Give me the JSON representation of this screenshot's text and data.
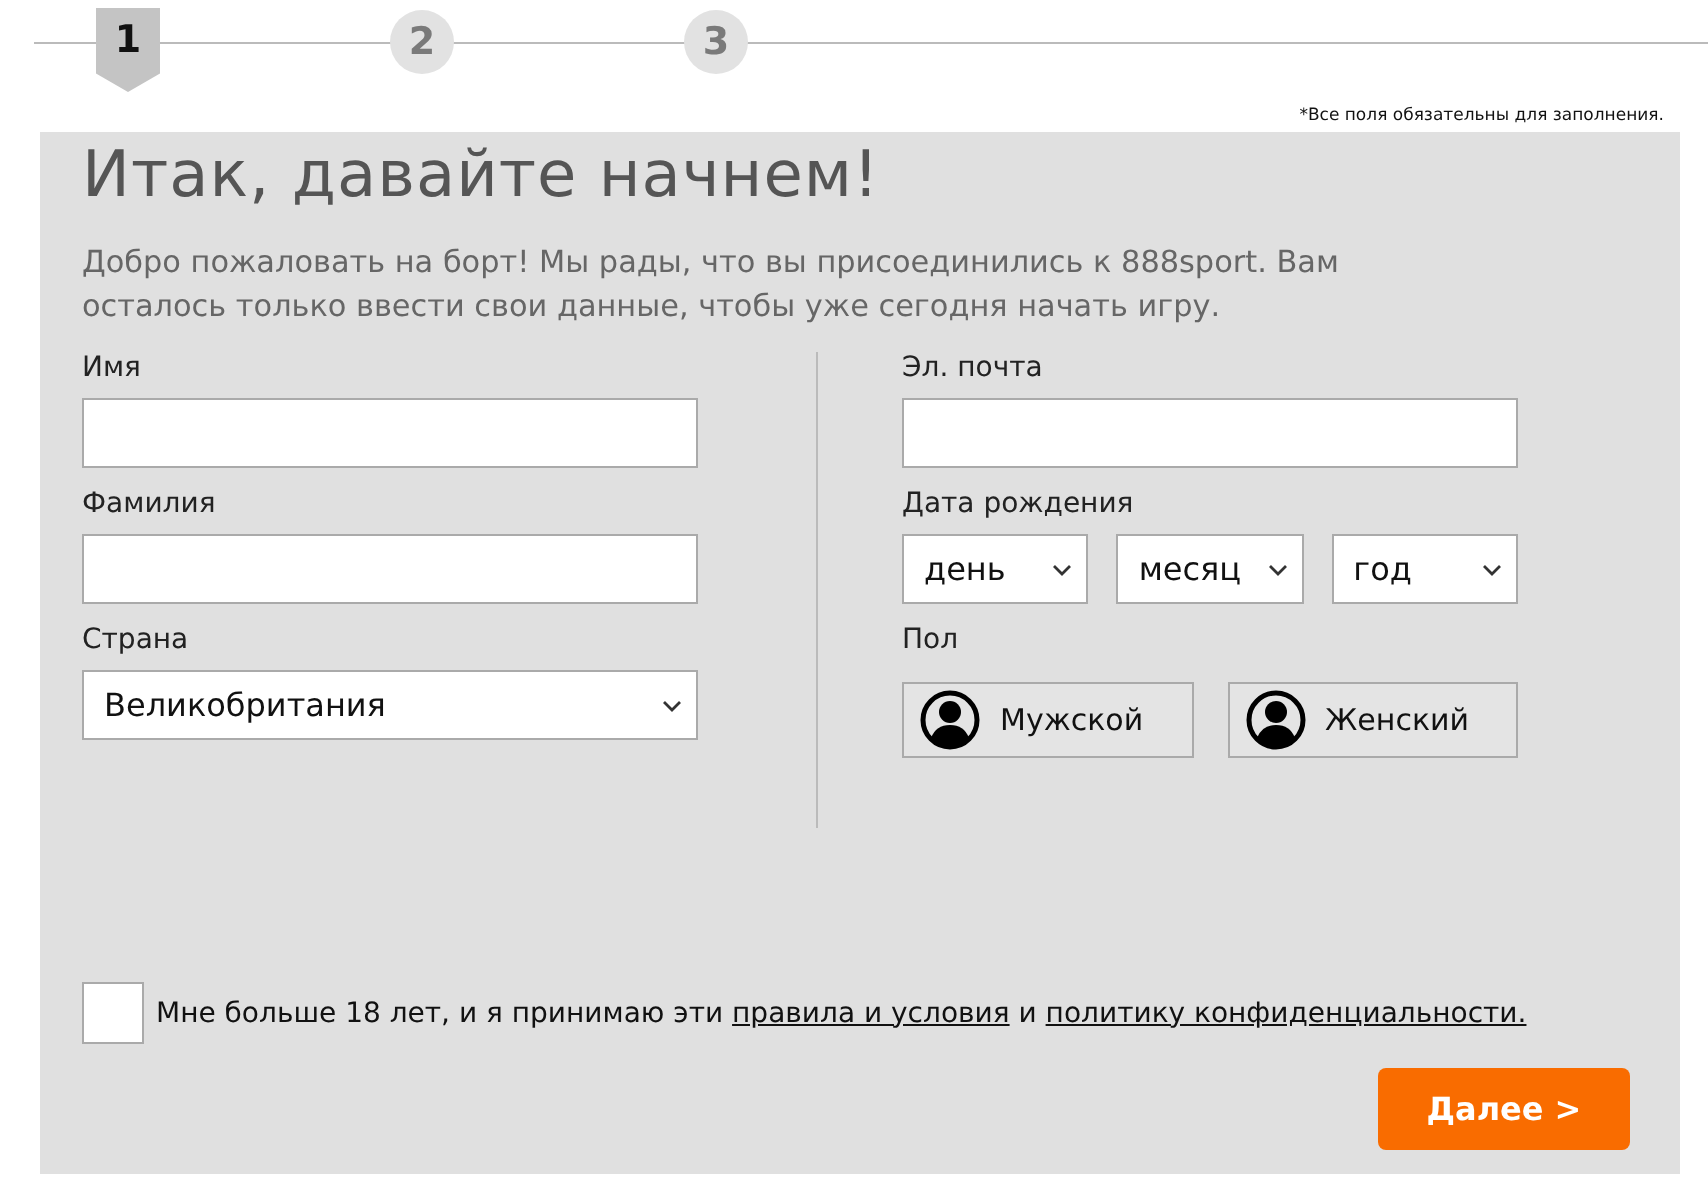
{
  "steps": [
    {
      "label": "1",
      "selected": true
    },
    {
      "label": "2",
      "selected": false
    },
    {
      "label": "3",
      "selected": false
    }
  ],
  "required_note": "*Все поля обязательны для заполнения.",
  "title": "Итак, давайте начнем!",
  "intro": "Добро пожаловать на борт! Мы рады, что вы присоединились к 888sport. Вам осталось только ввести свои данные, чтобы уже сегодня начать игру.",
  "left_fields": [
    {
      "label": "Имя",
      "kind": "text"
    },
    {
      "label": "Фамилия",
      "kind": "text"
    },
    {
      "label": "Страна",
      "kind": "select",
      "value": "Великобритания"
    }
  ],
  "email": {
    "label": "Эл. почта"
  },
  "birth_date": {
    "label": "Дата рождения",
    "selects": [
      "день",
      "месяц",
      "год"
    ]
  },
  "gender": {
    "label": "Пол",
    "options": [
      {
        "label": "Мужской",
        "selected": false
      },
      {
        "label": "Женский",
        "selected": false
      }
    ]
  },
  "agreement": {
    "checked": false,
    "text_before": "Мне больше 18 лет, и я принимаю эти ",
    "link_terms": "правила и условия",
    "middle": " и ",
    "link_privacy": "политику конфиденциальности."
  },
  "next_button": "Далее >"
}
